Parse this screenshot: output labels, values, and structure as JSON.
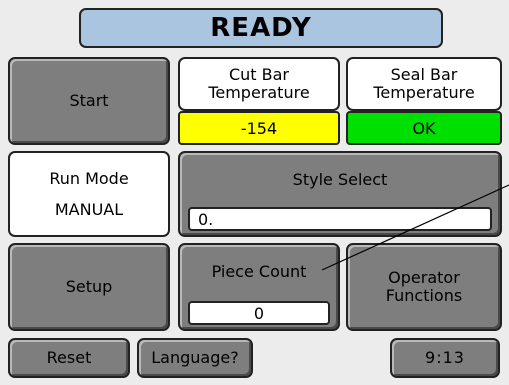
{
  "status": {
    "title": "READY",
    "color": "#a9c5e0"
  },
  "buttons": {
    "start": "Start",
    "setup": "Setup",
    "reset": "Reset",
    "language": "Language?",
    "operator_functions": "Operator\nFunctions"
  },
  "cut_bar": {
    "label": "Cut Bar\nTemperature",
    "value": "-154",
    "value_color": "#ffff00"
  },
  "seal_bar": {
    "label": "Seal Bar\nTemperature",
    "value": "OK",
    "value_color": "#00e000"
  },
  "run_mode": {
    "label": "Run Mode",
    "value": "MANUAL"
  },
  "style_select": {
    "label": "Style Select",
    "value": "0."
  },
  "piece_count": {
    "label": "Piece Count",
    "value": "0"
  },
  "clock": {
    "time": "9:13"
  }
}
